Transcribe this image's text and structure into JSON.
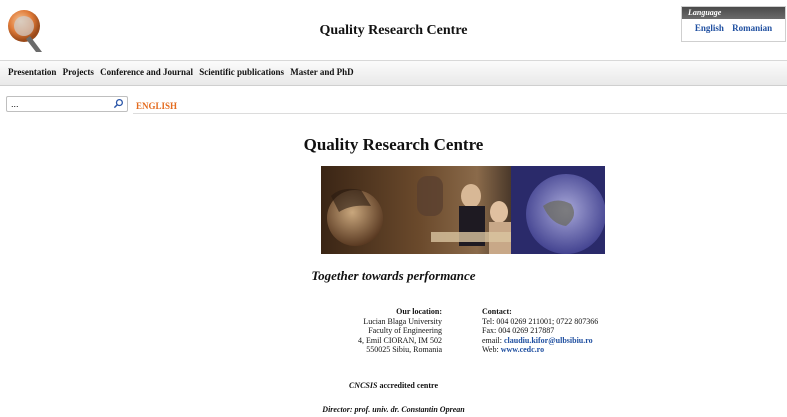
{
  "header": {
    "title": "Quality Research Centre",
    "language_box": {
      "heading": "Language",
      "options": [
        "English",
        "Romanian"
      ]
    }
  },
  "nav": {
    "items": [
      "Presentation",
      "Projects",
      "Conference and Journal",
      "Scientific publications",
      "Master and PhD"
    ]
  },
  "search": {
    "value": "...",
    "icon": "search-icon"
  },
  "current_language_label": "ENGLISH",
  "main": {
    "title": "Quality Research Centre",
    "tagline": "Together towards performance",
    "location": {
      "heading": "Our location:",
      "lines": [
        "Lucian Blaga University",
        "Faculty of Engineering",
        "4, Emil CIORAN, IM 502",
        "550025 Sibiu, Romania"
      ]
    },
    "contact": {
      "heading": "Contact:",
      "tel": "Tel: 004 0269 211001; 0722 807366",
      "fax": "Fax: 004 0269 217887",
      "email_label": "email: ",
      "email": "claudiu.kifor@ulbsibiu.ro",
      "web_label": "Web: ",
      "web": "www.cedc.ro"
    },
    "accreditation": {
      "org": "CNCSIS",
      "text": " accredited centre"
    },
    "director": "Director: prof. univ. dr. Constantin Oprean"
  },
  "colors": {
    "accent_orange": "#e46b1e",
    "link_blue": "#1f4fa0"
  }
}
